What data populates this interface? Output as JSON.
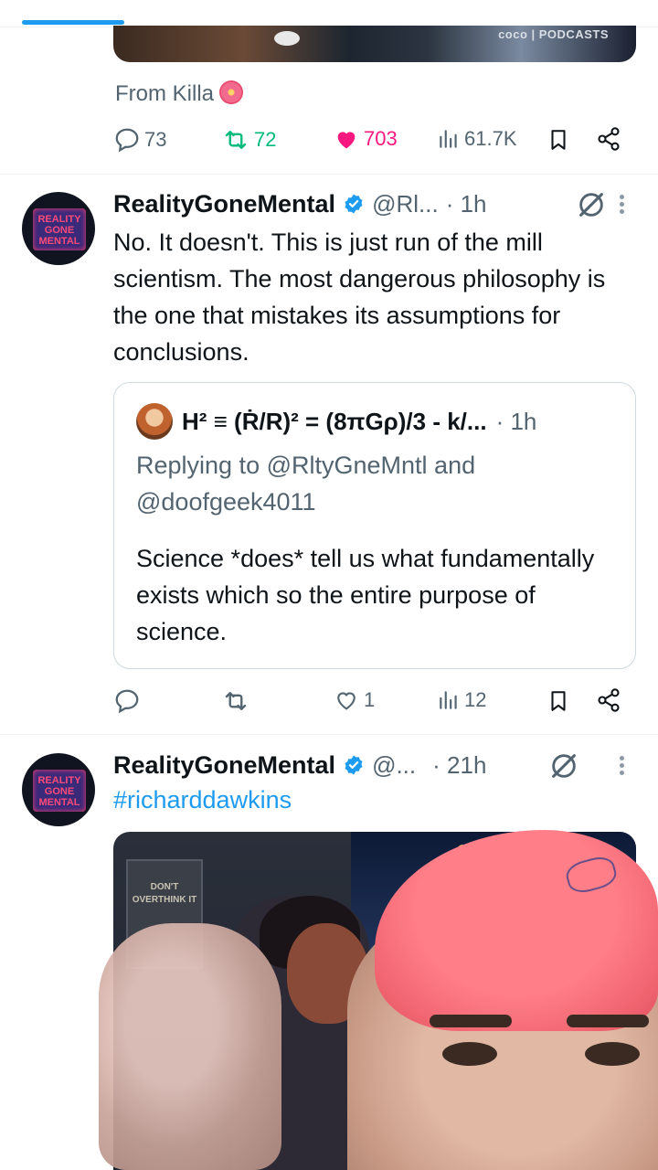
{
  "top_tweet": {
    "media_watermark": "coco | PODCASTS",
    "attribution": "From Killa",
    "actions": {
      "replies": "73",
      "retweets": "72",
      "likes": "703",
      "views": "61.7K"
    }
  },
  "tweet1": {
    "name": "RealityGoneMental",
    "handle": "@Rl...",
    "time": "· 1h",
    "avatar_text": "REALITY GONE MENTAL",
    "text": "No. It doesn't. This is just run of the mill scientism. The most dangerous philosophy is the one that mistakes its assumptions for conclusions.",
    "quote": {
      "name": "H² ≡ (Ṙ/R)² = (8πGρ)/3 - k/...",
      "time": "· 1h",
      "reply_prefix": "Replying to ",
      "reply_user1": "@RltyGneMntl",
      "reply_and": " and ",
      "reply_user2": "@doofgeek4011",
      "text": "Science *does* tell us what fundamentally exists which so the entire purpose of science."
    },
    "actions": {
      "replies": "",
      "retweets": "",
      "likes": "1",
      "views": "12"
    }
  },
  "tweet2": {
    "name": "RealityGoneMental",
    "handle": "@...",
    "time": "· 21h",
    "avatar_text": "REALITY GONE MENTAL",
    "hashtag": "#richarddawkins",
    "poster_text": "DON'T OVERTHINK IT"
  },
  "colors": {
    "accent": "#1d9bf0",
    "like": "#f91880",
    "retweet": "#00ba7c",
    "muted": "#536471"
  }
}
